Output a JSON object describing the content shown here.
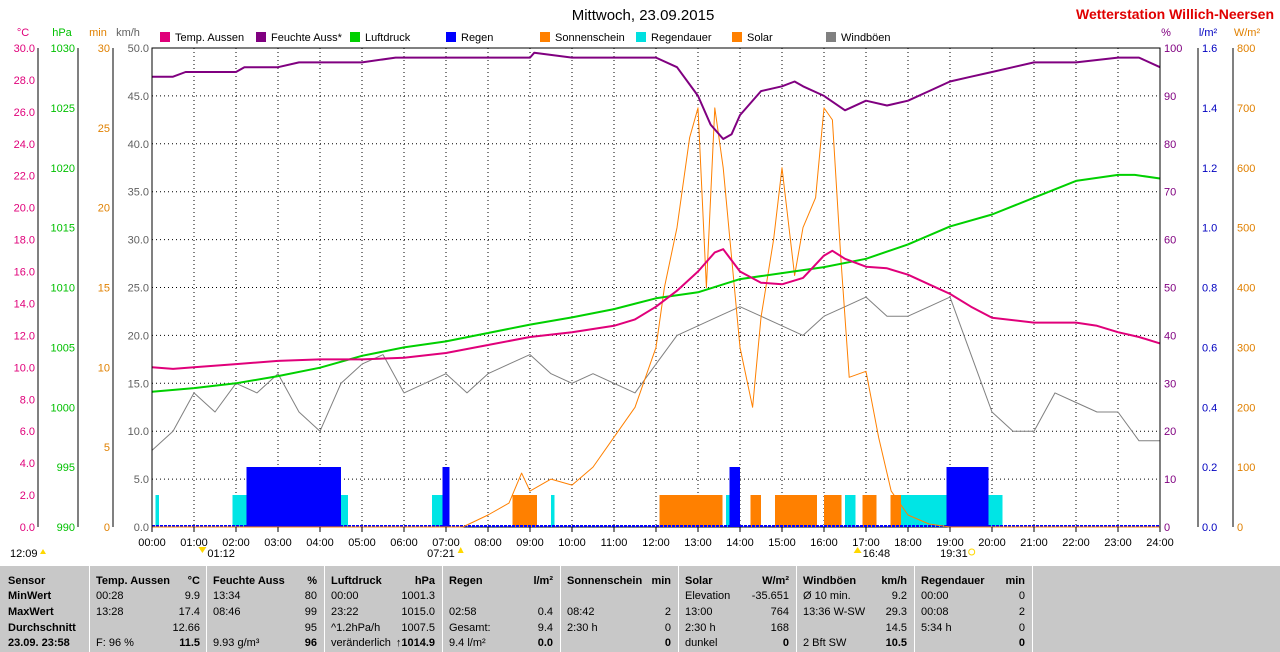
{
  "title": "Mittwoch, 23.09.2015",
  "station": "Wetterstation Willich-Neersen",
  "chart_data": {
    "type": "line",
    "x_range": [
      "00:00",
      "24:00"
    ],
    "x_ticks": [
      "00:00",
      "01:00",
      "02:00",
      "03:00",
      "04:00",
      "05:00",
      "06:00",
      "07:00",
      "08:00",
      "09:00",
      "10:00",
      "11:00",
      "12:00",
      "13:00",
      "14:00",
      "15:00",
      "16:00",
      "17:00",
      "18:00",
      "19:00",
      "20:00",
      "21:00",
      "22:00",
      "23:00",
      "24:00"
    ],
    "grid": true,
    "legend_placement": "top",
    "axes": {
      "temp": {
        "unit": "°C",
        "color": "#e0007a",
        "range": [
          0,
          30
        ],
        "ticks": [
          "30.0",
          "28.0",
          "26.0",
          "24.0",
          "22.0",
          "20.0",
          "18.0",
          "16.0",
          "14.0",
          "12.0",
          "10.0",
          "8.0",
          "6.0",
          "4.0",
          "2.0",
          "0.0"
        ]
      },
      "pressure": {
        "unit": "hPa",
        "color": "#00c000",
        "range": [
          990,
          1030
        ],
        "ticks": [
          "1030",
          "1025",
          "1020",
          "1015",
          "1010",
          "1005",
          "1000",
          "995",
          "990"
        ]
      },
      "minutes": {
        "unit": "min",
        "color": "#e08000",
        "range": [
          0,
          30
        ],
        "ticks": [
          "30",
          "25",
          "20",
          "15",
          "10",
          "5",
          "0"
        ]
      },
      "wind": {
        "unit": "km/h",
        "color": "#606060",
        "range": [
          0,
          50
        ],
        "ticks": [
          "50.0",
          "45.0",
          "40.0",
          "35.0",
          "30.0",
          "25.0",
          "20.0",
          "15.0",
          "10.0",
          "5.0",
          "0.0"
        ]
      },
      "humidity": {
        "unit": "%",
        "color": "#800080",
        "range": [
          0,
          100
        ],
        "ticks": [
          "100",
          "90",
          "80",
          "70",
          "60",
          "50",
          "40",
          "30",
          "20",
          "10",
          "0"
        ]
      },
      "rain": {
        "unit": "l/m²",
        "color": "#0000c0",
        "range": [
          0,
          1.6
        ],
        "ticks": [
          "1.6",
          "1.4",
          "1.2",
          "1.0",
          "0.8",
          "0.6",
          "0.4",
          "0.2",
          "0.0"
        ]
      },
      "solar": {
        "unit": "W/m²",
        "color": "#e08000",
        "range": [
          0,
          800
        ],
        "ticks": [
          "800",
          "700",
          "600",
          "500",
          "400",
          "300",
          "200",
          "100",
          "0"
        ]
      }
    },
    "legend": [
      {
        "name": "Temp. Aussen",
        "color": "#e0007a"
      },
      {
        "name": "Feuchte Auss*",
        "color": "#800080"
      },
      {
        "name": "Luftdruck",
        "color": "#00d000"
      },
      {
        "name": "Regen",
        "color": "#0000ff"
      },
      {
        "name": "Sonnenschein",
        "color": "#ff8000"
      },
      {
        "name": "Regendauer",
        "color": "#00e0e0"
      },
      {
        "name": "Solar",
        "color": "#ff8000"
      },
      {
        "name": "Windböen",
        "color": "#808080"
      }
    ],
    "series": [
      {
        "name": "Temp. Aussen",
        "axis": "temp",
        "x": [
          0,
          0.5,
          1,
          2,
          3,
          4,
          5,
          6,
          7,
          8,
          9,
          10,
          11,
          11.5,
          12,
          12.5,
          13,
          13.4,
          13.6,
          14,
          14.5,
          15,
          15.5,
          16,
          16.2,
          16.5,
          17,
          17.5,
          18,
          18.5,
          19,
          19.5,
          20,
          21,
          22,
          22.5,
          23,
          23.5,
          24
        ],
        "y": [
          10.0,
          9.9,
          10.0,
          10.2,
          10.4,
          10.5,
          10.5,
          10.6,
          10.9,
          11.4,
          11.9,
          12.2,
          12.6,
          13.0,
          13.8,
          14.8,
          16.0,
          17.2,
          17.4,
          16.0,
          15.3,
          15.2,
          15.6,
          17.0,
          17.3,
          16.8,
          16.3,
          16.2,
          15.8,
          15.2,
          14.6,
          13.8,
          13.1,
          12.8,
          12.8,
          12.6,
          12.2,
          11.9,
          11.5
        ]
      },
      {
        "name": "Feuchte Auss*",
        "axis": "humidity",
        "x": [
          0,
          0.5,
          0.8,
          1,
          2,
          2.2,
          3,
          3.5,
          4,
          5,
          5.8,
          6,
          7,
          8,
          9,
          9.1,
          10,
          11,
          12,
          12.5,
          13,
          13.3,
          13.6,
          13.8,
          14,
          14.5,
          15,
          15.3,
          15.5,
          16,
          16.5,
          17,
          17.5,
          18,
          18.5,
          19,
          19.5,
          20,
          20.5,
          21,
          22,
          23,
          23.5,
          24
        ],
        "y": [
          94,
          94,
          95,
          95,
          95,
          96,
          96,
          97,
          97,
          97,
          98,
          98,
          98,
          98,
          98,
          99,
          98,
          98,
          98,
          96,
          90,
          84,
          81,
          82,
          86,
          91,
          92,
          93,
          92,
          90,
          87,
          89,
          88,
          89,
          91,
          93,
          94,
          95,
          96,
          97,
          97,
          98,
          98,
          96
        ]
      },
      {
        "name": "Luftdruck",
        "axis": "pressure",
        "x": [
          0,
          1,
          2,
          3,
          4,
          5,
          6,
          7,
          8,
          9,
          10,
          11,
          12,
          13,
          14,
          15,
          16,
          17,
          18,
          19,
          20,
          21,
          22,
          23,
          23.4,
          24
        ],
        "y": [
          1001.3,
          1001.6,
          1002.0,
          1002.6,
          1003.3,
          1004.3,
          1005.0,
          1005.5,
          1006.2,
          1006.9,
          1007.5,
          1008.2,
          1009.1,
          1009.6,
          1010.7,
          1011.2,
          1011.7,
          1012.4,
          1013.6,
          1015.1,
          1016.1,
          1017.5,
          1018.9,
          1019.4,
          1019.4,
          1019.1
        ]
      },
      {
        "name": "Windböen",
        "axis": "wind",
        "x": [
          0,
          0.5,
          1,
          1.5,
          2,
          2.5,
          3,
          3.5,
          4,
          4.5,
          5,
          5.5,
          6,
          6.5,
          7,
          7.5,
          8,
          8.5,
          9,
          9.5,
          10,
          10.5,
          11,
          11.5,
          12,
          12.5,
          13,
          13.5,
          14,
          14.5,
          15,
          15.5,
          16,
          16.5,
          17,
          17.5,
          18,
          18.5,
          19,
          19.5,
          20,
          20.5,
          21,
          21.5,
          22,
          22.5,
          23,
          23.5,
          24
        ],
        "y": [
          8,
          10,
          14,
          12,
          15,
          14,
          16,
          12,
          10,
          15,
          17,
          18,
          14,
          15,
          16,
          14,
          16,
          17,
          18,
          16,
          15,
          16,
          15,
          14,
          17,
          20,
          21,
          22,
          23,
          22,
          21,
          20,
          22,
          23,
          24,
          22,
          22,
          23,
          24,
          18,
          12,
          10,
          10,
          14,
          13,
          12,
          12,
          9,
          9
        ]
      },
      {
        "name": "Solar",
        "axis": "solar",
        "x": [
          0,
          7.4,
          8,
          8.5,
          8.8,
          9,
          9.5,
          10,
          10.5,
          11,
          11.5,
          12,
          12.2,
          12.5,
          12.8,
          13,
          13.2,
          13.4,
          13.6,
          13.8,
          14,
          14.3,
          14.5,
          14.8,
          15,
          15.3,
          15.5,
          15.8,
          16,
          16.2,
          16.4,
          16.6,
          17,
          17.3,
          17.6,
          18,
          18.5,
          19,
          20,
          24
        ],
        "y": [
          0,
          0,
          20,
          40,
          90,
          60,
          80,
          70,
          100,
          150,
          200,
          300,
          400,
          500,
          650,
          700,
          400,
          700,
          600,
          450,
          300,
          200,
          350,
          480,
          600,
          420,
          500,
          550,
          700,
          680,
          450,
          250,
          260,
          150,
          60,
          20,
          5,
          0,
          0,
          0
        ]
      }
    ],
    "regen_blocks": [
      {
        "from": "02:15",
        "to": "04:30"
      },
      {
        "from": "06:55",
        "to": "07:05"
      },
      {
        "from": "13:45",
        "to": "14:00"
      },
      {
        "from": "18:55",
        "to": "19:55"
      }
    ],
    "regendauer_blocks": [
      {
        "from": "00:05",
        "to": "00:10"
      },
      {
        "from": "01:55",
        "to": "04:40"
      },
      {
        "from": "06:40",
        "to": "07:05"
      },
      {
        "from": "09:30",
        "to": "09:35"
      },
      {
        "from": "13:40",
        "to": "14:00"
      },
      {
        "from": "16:30",
        "to": "16:45"
      },
      {
        "from": "17:50",
        "to": "20:15"
      }
    ],
    "sonnenschein_blocks": [
      {
        "from": "08:35",
        "to": "09:10"
      },
      {
        "from": "12:05",
        "to": "13:35"
      },
      {
        "from": "14:15",
        "to": "14:30"
      },
      {
        "from": "14:50",
        "to": "15:50"
      },
      {
        "from": "16:00",
        "to": "16:25"
      },
      {
        "from": "16:55",
        "to": "17:15"
      },
      {
        "from": "17:35",
        "to": "17:50"
      }
    ],
    "markers": {
      "left_time": "12:09",
      "sunrise": "07:21",
      "sunset": "19:31",
      "min_temp_time": "01:12",
      "max_solar_time": "16:48"
    }
  },
  "table": {
    "row_labels": [
      "Sensor",
      "MinWert",
      "MaxWert",
      "Durchschnitt",
      "23.09.  23:58"
    ],
    "columns": [
      {
        "header": "Temp. Aussen",
        "unit": "°C",
        "rows": [
          [
            "00:28",
            "9.9"
          ],
          [
            "13:28",
            "17.4"
          ],
          [
            "",
            "12.66"
          ],
          [
            "F: 96 %",
            "11.5"
          ]
        ]
      },
      {
        "header": "Feuchte Auss",
        "unit": "%",
        "rows": [
          [
            "13:34",
            "80"
          ],
          [
            "08:46",
            "99"
          ],
          [
            "",
            "95"
          ],
          [
            "9.93 g/m³",
            "96"
          ]
        ]
      },
      {
        "header": "Luftdruck",
        "unit": "hPa",
        "rows": [
          [
            "00:00",
            "1001.3"
          ],
          [
            "23:22",
            "1015.0"
          ],
          [
            "^1.2hPa/h",
            "1007.5"
          ],
          [
            "veränderlich",
            "↑1014.9"
          ]
        ]
      },
      {
        "header": "Regen",
        "unit": "l/m²",
        "rows": [
          [
            "",
            ""
          ],
          [
            "02:58",
            "0.4"
          ],
          [
            "Gesamt:",
            "9.4"
          ],
          [
            "9.4 l/m²",
            "0.0"
          ]
        ]
      },
      {
        "header": "Sonnenschein",
        "unit": "min",
        "rows": [
          [
            "",
            ""
          ],
          [
            "08:42",
            "2"
          ],
          [
            "2:30 h",
            "0"
          ],
          [
            "",
            "0"
          ]
        ]
      },
      {
        "header": "Solar",
        "unit": "W/m²",
        "rows": [
          [
            "Elevation",
            "-35.651"
          ],
          [
            "13:00",
            "764"
          ],
          [
            "2:30 h",
            "168"
          ],
          [
            "dunkel",
            "0"
          ]
        ]
      },
      {
        "header": "Windböen",
        "unit": "km/h",
        "rows": [
          [
            "Ø 10 min.",
            "9.2"
          ],
          [
            "13:36  W-SW",
            "29.3"
          ],
          [
            "",
            "14.5"
          ],
          [
            "2 Bft SW",
            "10.5"
          ]
        ]
      },
      {
        "header": "Regendauer",
        "unit": "min",
        "rows": [
          [
            "00:00",
            "0"
          ],
          [
            "00:08",
            "2"
          ],
          [
            "5:34 h",
            "0"
          ],
          [
            "",
            "0"
          ]
        ]
      }
    ]
  }
}
